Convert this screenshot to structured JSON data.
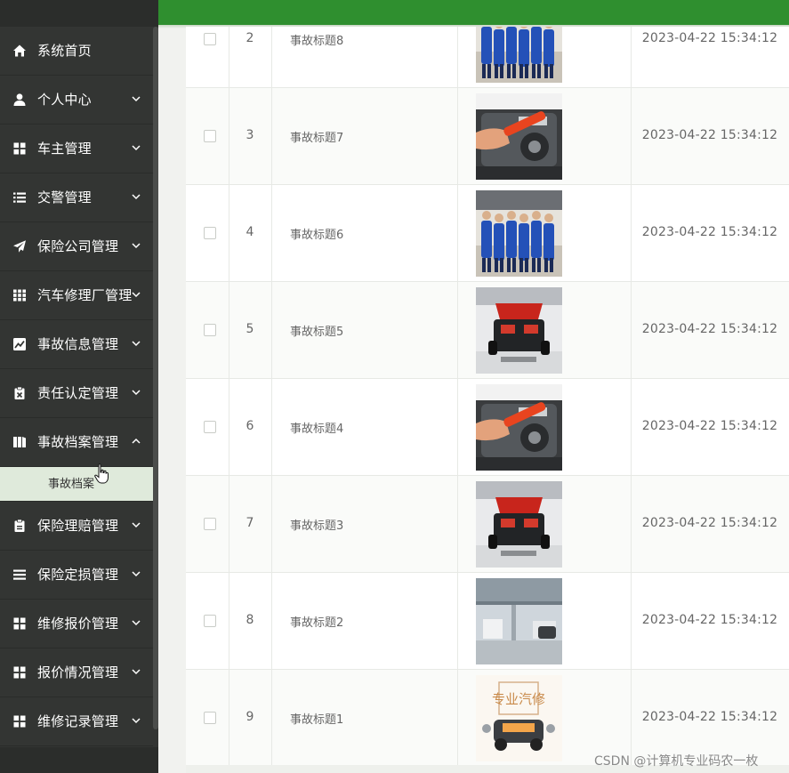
{
  "sidebar": {
    "items": [
      {
        "label": "系统首页",
        "icon": "home-icon",
        "chevron": false
      },
      {
        "label": "个人中心",
        "icon": "user-icon",
        "chevron": true
      },
      {
        "label": "车主管理",
        "icon": "grid-icon",
        "chevron": true
      },
      {
        "label": "交警管理",
        "icon": "list-icon",
        "chevron": true
      },
      {
        "label": "保险公司管理",
        "icon": "send-icon",
        "chevron": true
      },
      {
        "label": "汽车修理厂管理",
        "icon": "building-icon",
        "chevron": true
      },
      {
        "label": "事故信息管理",
        "icon": "chart-icon",
        "chevron": true
      },
      {
        "label": "责任认定管理",
        "icon": "clipboard-x-icon",
        "chevron": true
      },
      {
        "label": "事故档案管理",
        "icon": "folder-icon",
        "chevron": true,
        "expanded": true,
        "children": [
          {
            "label": "事故档案"
          }
        ]
      },
      {
        "label": "保险理赔管理",
        "icon": "clipboard-icon",
        "chevron": true
      },
      {
        "label": "保险定损管理",
        "icon": "menu-icon",
        "chevron": true
      },
      {
        "label": "维修报价管理",
        "icon": "grid-icon",
        "chevron": true
      },
      {
        "label": "报价情况管理",
        "icon": "grid-icon",
        "chevron": true
      },
      {
        "label": "维修记录管理",
        "icon": "grid-icon",
        "chevron": true
      }
    ]
  },
  "table": {
    "rows": [
      {
        "index": "2",
        "title": "事故标题8",
        "image": "mechanics-group-photo",
        "time": "2023-04-22 15:34:12"
      },
      {
        "index": "3",
        "title": "事故标题7",
        "image": "wrench-engine-photo",
        "time": "2023-04-22 15:34:12"
      },
      {
        "index": "4",
        "title": "事故标题6",
        "image": "mechanics-group-photo",
        "time": "2023-04-22 15:34:12"
      },
      {
        "index": "5",
        "title": "事故标题5",
        "image": "red-car-hood-photo",
        "time": "2023-04-22 15:34:12"
      },
      {
        "index": "6",
        "title": "事故标题4",
        "image": "wrench-engine-photo",
        "time": "2023-04-22 15:34:12"
      },
      {
        "index": "7",
        "title": "事故标题3",
        "image": "red-car-hood-photo",
        "time": "2023-04-22 15:34:12"
      },
      {
        "index": "8",
        "title": "事故标题2",
        "image": "workshop-hall-photo",
        "time": "2023-04-22 15:34:12"
      },
      {
        "index": "9",
        "title": "事故标题1",
        "image": "repair-logo-photo",
        "time": "2023-04-22 15:34:12"
      }
    ]
  },
  "logo": {
    "text": "专业汽修"
  },
  "watermark": "CSDN @计算机专业码农一枚",
  "colors": {
    "topbar": "#2f8f2f",
    "sidebar": "#333533",
    "active_sub": "#dfeadb"
  }
}
